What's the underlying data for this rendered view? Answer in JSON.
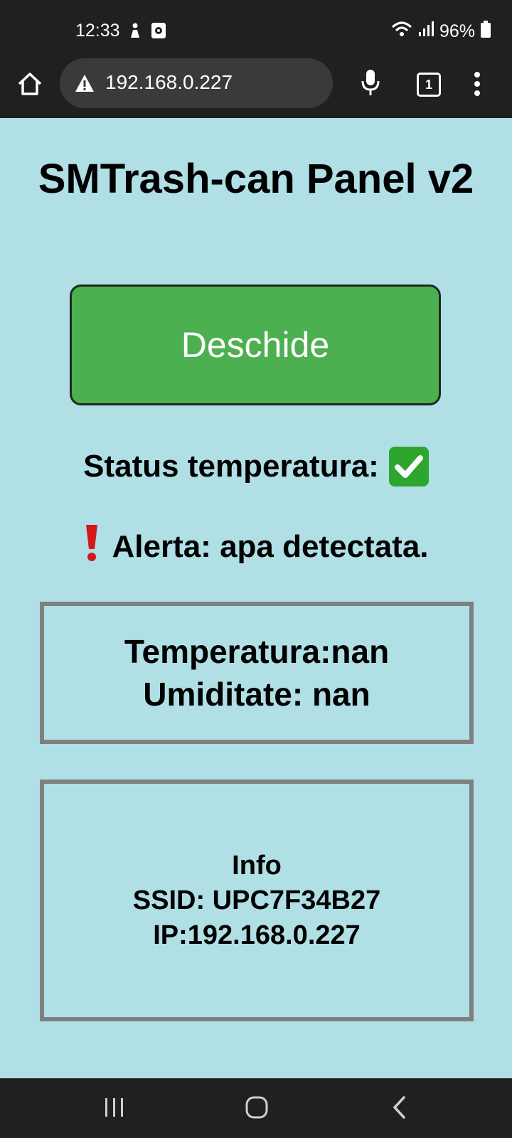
{
  "status_bar": {
    "time": "12:33",
    "battery": "96%",
    "icons": [
      "person-icon",
      "media-icon",
      "wifi-icon",
      "signal-icon",
      "battery-icon"
    ]
  },
  "browser": {
    "url": "192.168.0.227",
    "tab_count": "1",
    "icons": [
      "home-icon",
      "warning-icon",
      "mic-icon",
      "tabs-icon",
      "more-vert-icon"
    ]
  },
  "page": {
    "title": "SMTrash-can Panel v2",
    "open_button": "Deschide",
    "temp_status_label": "Status temperatura:",
    "alert_text": "Alerta: apa detectata.",
    "sensor": {
      "temperature": "Temperatura:nan",
      "humidity": "Umiditate: nan"
    },
    "info": {
      "heading": "Info",
      "ssid": "SSID: UPC7F34B27",
      "ip": "IP:192.168.0.227"
    }
  },
  "colors": {
    "background": "#b0dfe5",
    "button": "#4caf50",
    "alert": "#d31919",
    "check": "#2ea52e"
  }
}
